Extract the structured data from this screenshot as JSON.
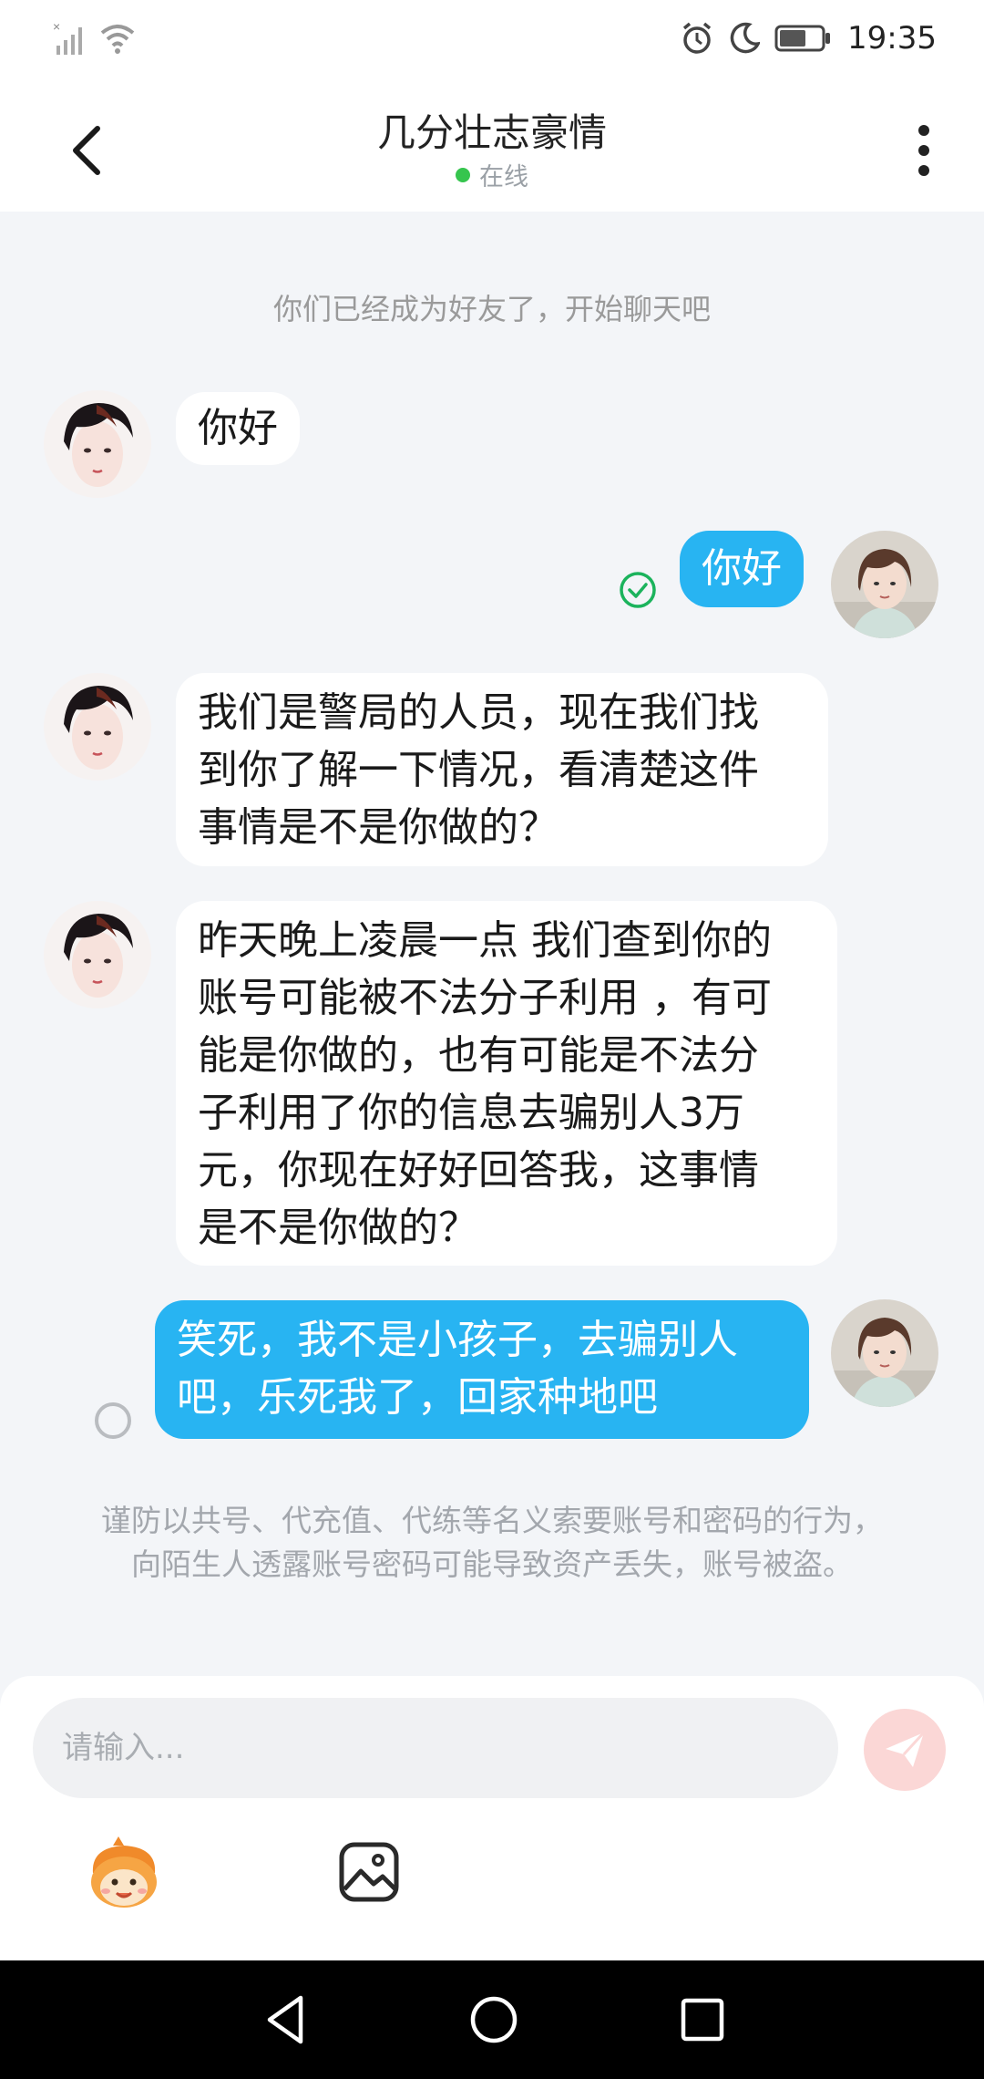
{
  "status_bar": {
    "time": "19:35",
    "icons": [
      "signal-icon",
      "wifi-icon",
      "alarm-icon",
      "moon-icon",
      "battery-icon"
    ]
  },
  "header": {
    "title": "几分壮志豪情",
    "presence": "在线",
    "icons": [
      "back-arrow-icon",
      "more-vertical-icon"
    ]
  },
  "system_message": "你们已经成为好友了，开始聊天吧",
  "messages": [
    {
      "sender": "contact",
      "text": "你好"
    },
    {
      "sender": "me",
      "text": "你好",
      "status": "read"
    },
    {
      "sender": "contact",
      "text": "我们是警局的人员，现在我们找\n到你了解一下情况，看清楚这件\n事情是不是你做的？"
    },
    {
      "sender": "contact",
      "text": "昨天晚上凌晨一点 我们查到你的\n账号可能被不法分子利用 ，有可\n能是你做的，也有可能是不法分\n子利用了你的信息去骗别人3万\n元，你现在好好回答我，这事情\n是不是你做的？"
    },
    {
      "sender": "me",
      "text": "笑死，我不是小孩子，去骗别人\n吧，乐死我了，回家种地吧",
      "status": "pending"
    }
  ],
  "warning": "谨防以共号、代充值、代练等名义索要账号和密码的行为，向陌生人透露账号密码可能导致资产丢失，账号被盗。",
  "composer": {
    "placeholder": "请输入...",
    "icons": [
      "send-icon",
      "emoji-icon",
      "image-icon"
    ]
  },
  "nav_bar": {
    "icons": [
      "nav-back-icon",
      "nav-home-icon",
      "nav-recent-icon"
    ]
  },
  "colors": {
    "accent": "#28b4f2",
    "online": "#36c54e",
    "background": "#f3f5f8",
    "send_button": "#fbd7d6"
  }
}
